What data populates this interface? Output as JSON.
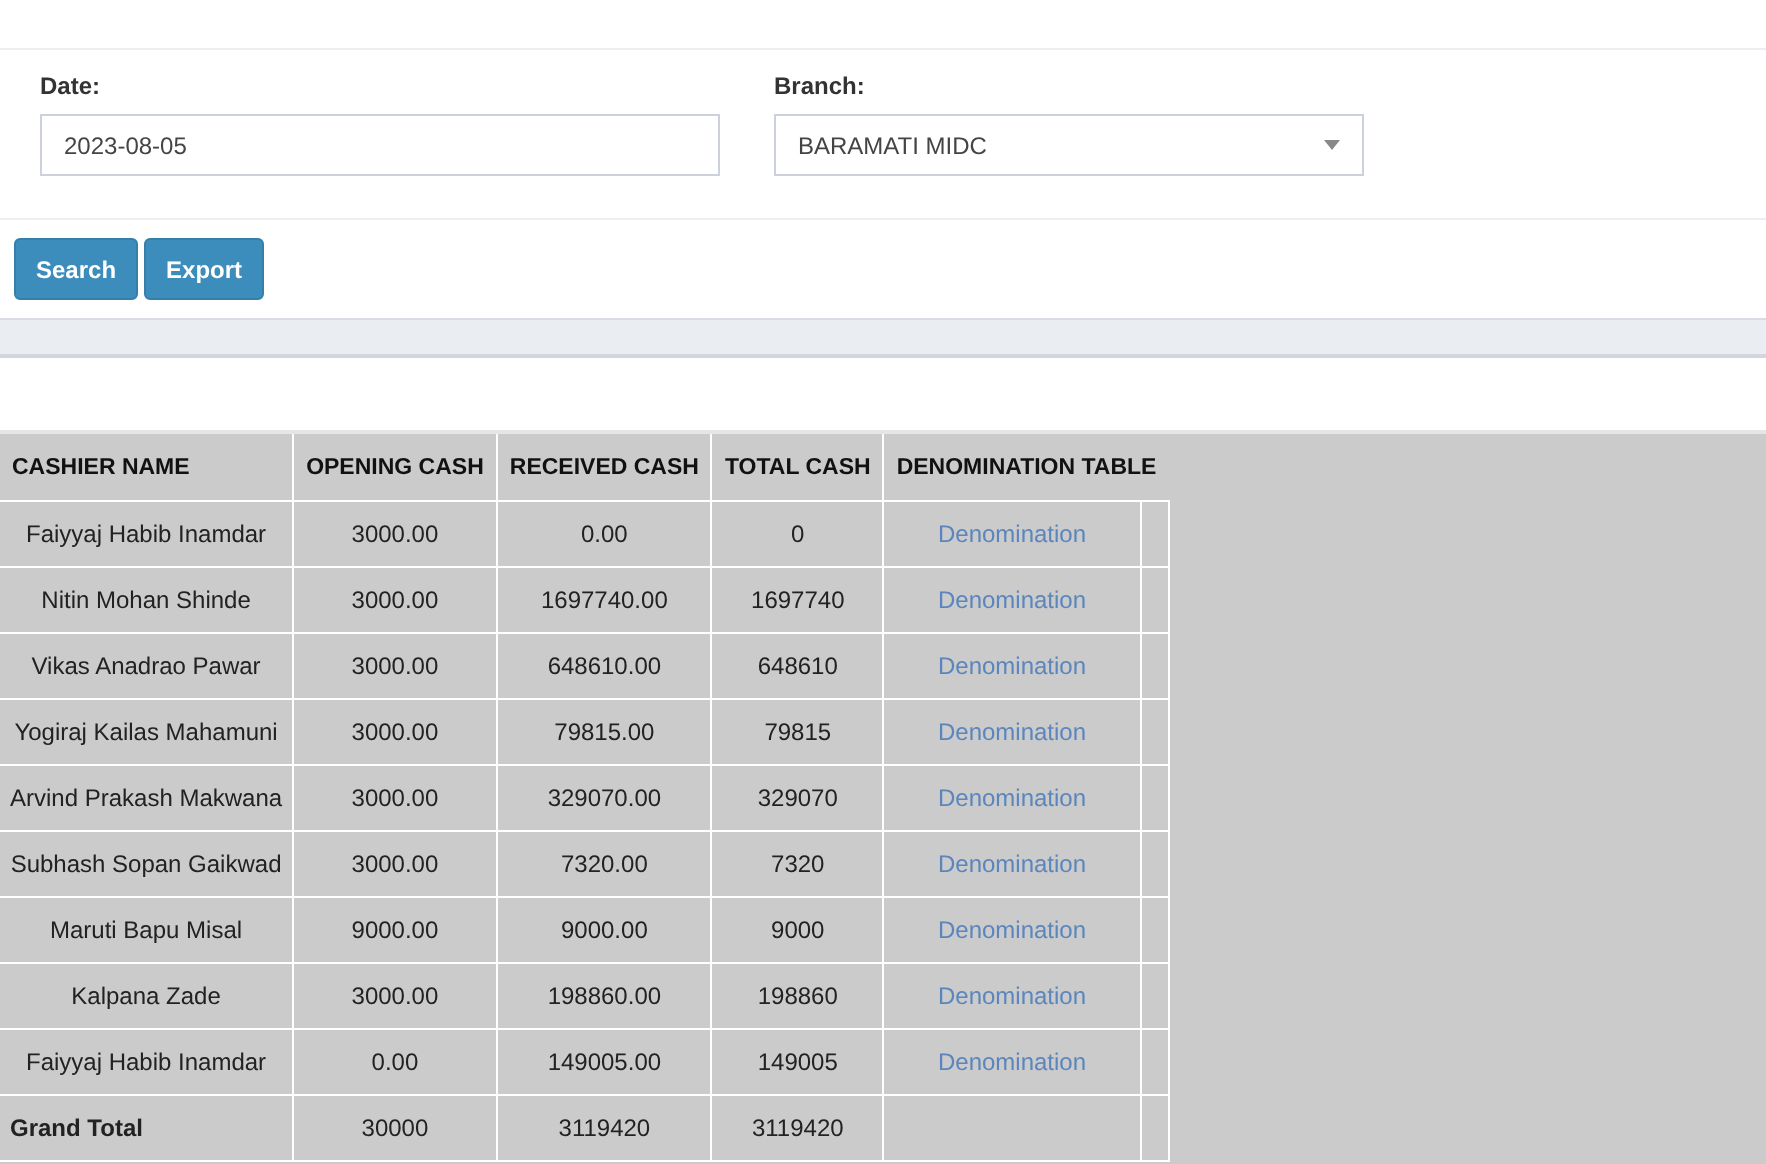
{
  "filters": {
    "date": {
      "label": "Date:",
      "value": "2023-08-05"
    },
    "branch": {
      "label": "Branch:",
      "value": "BARAMATI MIDC"
    }
  },
  "buttons": [
    "Search",
    "Export"
  ],
  "table": {
    "columns": [
      "CASHIER NAME",
      "OPENING CASH",
      "RECEIVED CASH",
      "TOTAL CASH",
      "DENOMINATION TABLE"
    ],
    "rows": [
      {
        "name": "Faiyyaj Habib Inamdar",
        "opening": "3000.00",
        "received": "0.00",
        "total": "0",
        "link": "Denomination"
      },
      {
        "name": "Nitin Mohan Shinde",
        "opening": "3000.00",
        "received": "1697740.00",
        "total": "1697740",
        "link": "Denomination"
      },
      {
        "name": "Vikas Anadrao Pawar",
        "opening": "3000.00",
        "received": "648610.00",
        "total": "648610",
        "link": "Denomination"
      },
      {
        "name": "Yogiraj Kailas Mahamuni",
        "opening": "3000.00",
        "received": "79815.00",
        "total": "79815",
        "link": "Denomination"
      },
      {
        "name": "Arvind Prakash Makwana",
        "opening": "3000.00",
        "received": "329070.00",
        "total": "329070",
        "link": "Denomination"
      },
      {
        "name": "Subhash Sopan Gaikwad",
        "opening": "3000.00",
        "received": "7320.00",
        "total": "7320",
        "link": "Denomination"
      },
      {
        "name": "Maruti Bapu Misal",
        "opening": "9000.00",
        "received": "9000.00",
        "total": "9000",
        "link": "Denomination"
      },
      {
        "name": "Kalpana Zade",
        "opening": "3000.00",
        "received": "198860.00",
        "total": "198860",
        "link": "Denomination"
      },
      {
        "name": "Faiyyaj Habib Inamdar",
        "opening": "0.00",
        "received": "149005.00",
        "total": "149005",
        "link": "Denomination"
      }
    ],
    "total": {
      "label": "Grand Total",
      "opening": "30000",
      "received": "3119420",
      "total": "3119420"
    }
  }
}
